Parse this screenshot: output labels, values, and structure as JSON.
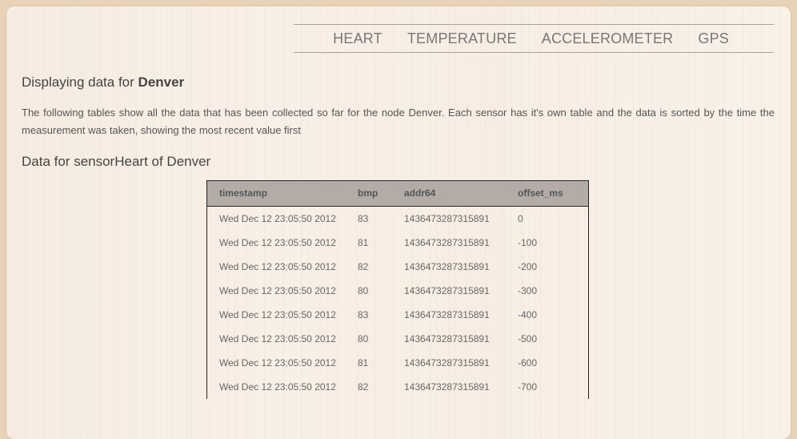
{
  "nav": {
    "items": [
      "HEART",
      "TEMPERATURE",
      "ACCELEROMETER",
      "GPS"
    ]
  },
  "heading": {
    "prefix": "Displaying data for",
    "node": "Denver"
  },
  "description": "The following tables show all the data that has been collected so far for the node Denver. Each sensor has it's own table and the data is sorted by the time the measurement was taken, showing the most recent value first",
  "section_title": "Data for sensorHeart of Denver",
  "table": {
    "columns": [
      "timestamp",
      "bmp",
      "addr64",
      "offset_ms"
    ],
    "rows": [
      [
        "Wed Dec 12 23:05:50 2012",
        "83",
        "1436473287315891",
        "0"
      ],
      [
        "Wed Dec 12 23:05:50 2012",
        "81",
        "1436473287315891",
        "-100"
      ],
      [
        "Wed Dec 12 23:05:50 2012",
        "82",
        "1436473287315891",
        "-200"
      ],
      [
        "Wed Dec 12 23:05:50 2012",
        "80",
        "1436473287315891",
        "-300"
      ],
      [
        "Wed Dec 12 23:05:50 2012",
        "83",
        "1436473287315891",
        "-400"
      ],
      [
        "Wed Dec 12 23:05:50 2012",
        "80",
        "1436473287315891",
        "-500"
      ],
      [
        "Wed Dec 12 23:05:50 2012",
        "81",
        "1436473287315891",
        "-600"
      ],
      [
        "Wed Dec 12 23:05:50 2012",
        "82",
        "1436473287315891",
        "-700"
      ]
    ]
  }
}
